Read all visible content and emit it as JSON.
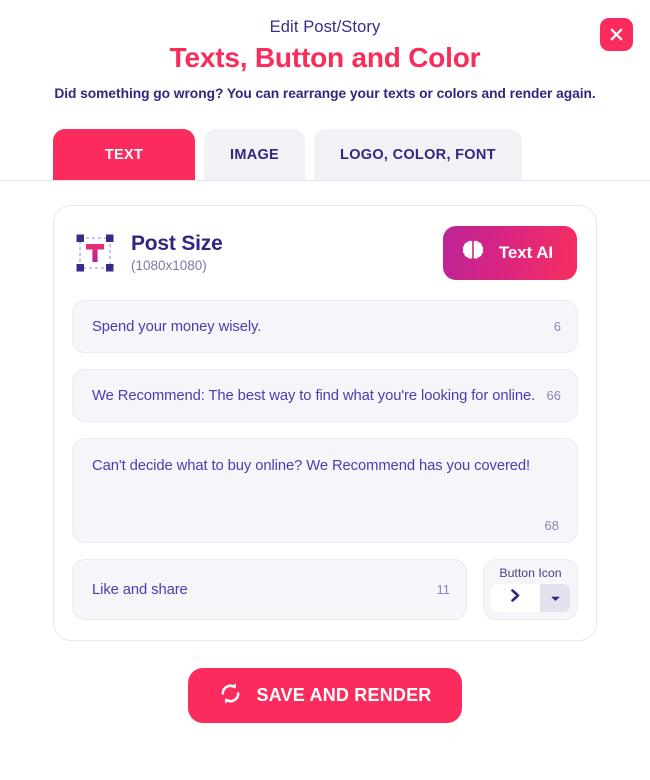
{
  "header": {
    "eyebrow": "Edit Post/Story",
    "title": "Texts, Button and Color",
    "subtitle": "Did something go wrong? You can rearrange your texts or colors and render again.",
    "close_label": "close-icon",
    "accent_color": "#fb2c5d",
    "title_color": "#fa2c5c",
    "dark_color": "#35257f"
  },
  "tabs": [
    {
      "label": "TEXT",
      "active": true
    },
    {
      "label": "IMAGE",
      "active": false
    },
    {
      "label": "LOGO, COLOR, FONT",
      "active": false
    }
  ],
  "card": {
    "post_size": {
      "title": "Post Size",
      "dimensions": "(1080x1080)",
      "icon": "text-tool-icon"
    },
    "ai_button": {
      "label": "Text AI",
      "icon": "brain-icon",
      "gradient_from": "#bb2597",
      "gradient_to": "#f72e5f"
    },
    "fields": [
      {
        "name": "headline-field",
        "value": "Spend your money wisely.",
        "counter": "6",
        "multiline": false
      },
      {
        "name": "subheadline-field",
        "value": "We Recommend: The best way to find what you're looking for online.",
        "counter": "66",
        "multiline": false
      },
      {
        "name": "body-field",
        "value": "Can't decide what to buy online? We Recommend has you covered!",
        "counter": "68",
        "multiline": true
      }
    ],
    "button_field": {
      "name": "button-text-field",
      "value": "Like and share",
      "counter": "11"
    },
    "button_icon": {
      "label": "Button Icon",
      "selected_icon": "chevron-right-icon",
      "caret": "chevron-down-icon"
    }
  },
  "footer": {
    "save_label": "SAVE AND RENDER",
    "save_icon": "refresh-icon"
  }
}
